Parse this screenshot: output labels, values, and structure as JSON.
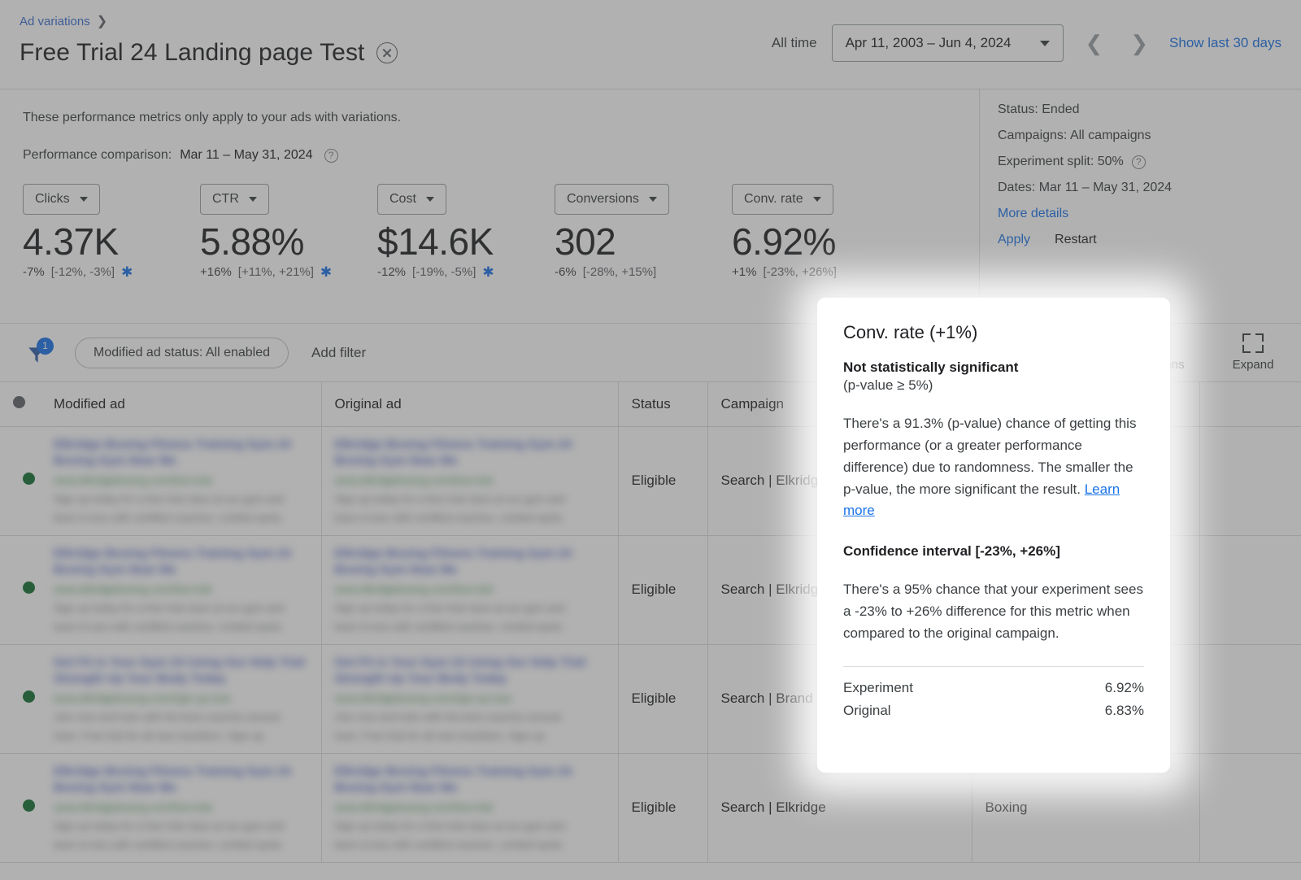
{
  "header": {
    "breadcrumb": "Ad variations",
    "breadcrumb_chevron": "chevron-right-icon",
    "title": "Free Trial 24 Landing page Test",
    "all_time_label": "All time",
    "date_range": "Apr 11, 2003 – Jun 4, 2024",
    "show_last_30": "Show last 30 days"
  },
  "info": {
    "note": "These performance metrics only apply to your ads with variations.",
    "comparison_label": "Performance comparison:",
    "comparison_dates": "Mar 11 – May 31, 2024"
  },
  "metrics": [
    {
      "name": "Clicks",
      "value": "4.37K",
      "delta": "-7%",
      "ci": "[-12%, -3%]",
      "significant": true
    },
    {
      "name": "CTR",
      "value": "5.88%",
      "delta": "+16%",
      "ci": "[+11%, +21%]",
      "significant": true
    },
    {
      "name": "Cost",
      "value": "$14.6K",
      "delta": "-12%",
      "ci": "[-19%, -5%]",
      "significant": true
    },
    {
      "name": "Conversions",
      "value": "302",
      "delta": "-6%",
      "ci": "[-28%, +15%]",
      "significant": false
    },
    {
      "name": "Conv. rate",
      "value": "6.92%",
      "delta": "+1%",
      "ci": "[-23%, +26%]",
      "significant": false
    }
  ],
  "sidepanel": {
    "status": "Status: Ended",
    "campaigns": "Campaigns: All campaigns",
    "experiment_split": "Experiment split: 50%",
    "dates": "Dates: Mar 11 – May 31, 2024",
    "more_details": "More details",
    "apply": "Apply",
    "restart": "Restart"
  },
  "filterbar": {
    "filter_count": "1",
    "chip": "Modified ad status: All enabled",
    "add_filter": "Add filter",
    "columns_label": "Columns",
    "expand_label": "Expand"
  },
  "table": {
    "headers": [
      "Modified ad",
      "Original ad",
      "Status",
      "Campaign",
      "",
      ""
    ],
    "rows": [
      {
        "status": "Eligible",
        "campaign": "Search | Elkridge",
        "extra": ""
      },
      {
        "status": "Eligible",
        "campaign": "Search | Elkridge",
        "extra": ""
      },
      {
        "status": "Eligible",
        "campaign": "Search | Brand",
        "extra": ""
      },
      {
        "status": "Eligible",
        "campaign": "Search | Elkridge",
        "extra": "Boxing"
      }
    ]
  },
  "tooltip": {
    "title": "Conv. rate (+1%)",
    "significance": "Not statistically significant",
    "pvalue_note": "(p-value ≥ 5%)",
    "paragraph": "There's a 91.3% (p-value) chance of getting this performance (or a greater performance difference) due to randomness. The smaller the p-value, the more significant the result. ",
    "learn_more": "Learn more",
    "ci_heading": "Confidence interval [-23%, +26%]",
    "ci_paragraph": "There's a 95% chance that your experiment sees a -23% to +26% difference for this metric when compared to the original campaign.",
    "experiment_label": "Experiment",
    "experiment_value": "6.92%",
    "original_label": "Original",
    "original_value": "6.83%"
  },
  "colors": {
    "accent_blue": "#1a73e8",
    "status_green": "#137333",
    "text_primary": "#202124",
    "text_secondary": "#5f6368",
    "border": "#dadce0"
  }
}
